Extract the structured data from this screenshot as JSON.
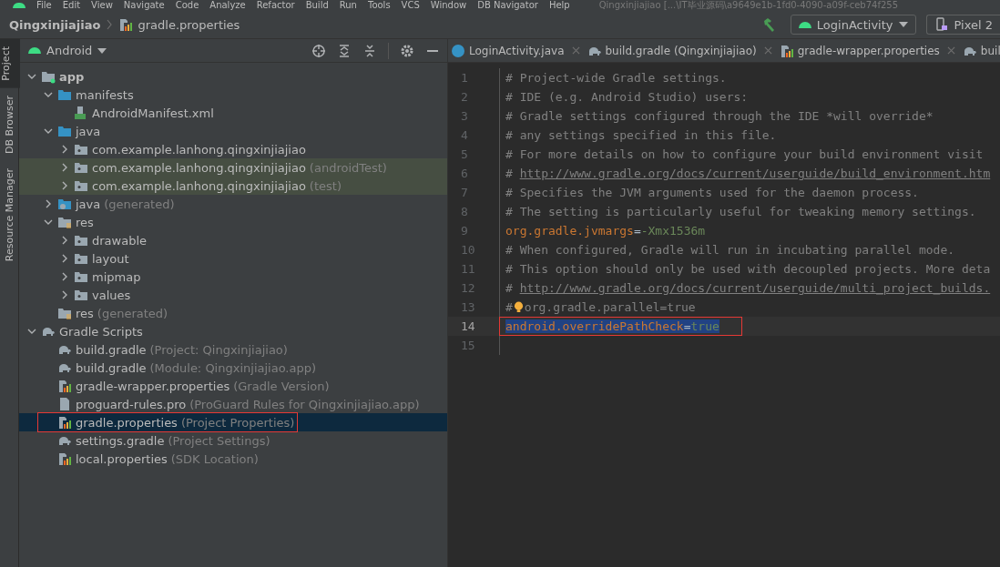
{
  "menu_bar": {
    "items": [
      "File",
      "Edit",
      "View",
      "Navigate",
      "Code",
      "Analyze",
      "Refactor",
      "Build",
      "Run",
      "Tools",
      "VCS",
      "Window",
      "DB Navigator",
      "Help"
    ],
    "window_title": "Qingxinjiajiao [...\\IT毕业源码\\a9649e1b-1fd0-4090-a09f-ceb74f255"
  },
  "breadcrumb": {
    "project": "Qingxinjiajiao",
    "file": "gradle.properties"
  },
  "run_config": {
    "configuration": "LoginActivity",
    "device": "Pixel 2"
  },
  "side_tabs": [
    {
      "label": "Project",
      "selected": true
    },
    {
      "label": "DB Browser",
      "selected": false
    },
    {
      "label": "Resource Manager",
      "selected": false
    }
  ],
  "project_panel": {
    "view": "Android",
    "tree": [
      {
        "name": "app",
        "kind": "module",
        "expanded": true,
        "children": [
          {
            "name": "manifests",
            "kind": "folder",
            "expanded": true,
            "children": [
              {
                "name": "AndroidManifest.xml",
                "kind": "manifest"
              }
            ]
          },
          {
            "name": "java",
            "kind": "folder",
            "expanded": true,
            "children": [
              {
                "name": "com.example.lanhong.qingxinjiajiao",
                "kind": "package",
                "expanded": false
              },
              {
                "name": "com.example.lanhong.qingxinjiajiao",
                "suffix": "(androidTest)",
                "kind": "package",
                "expanded": false,
                "highlighted": true
              },
              {
                "name": "com.example.lanhong.qingxinjiajiao",
                "suffix": "(test)",
                "kind": "package",
                "expanded": false,
                "highlighted": true
              }
            ]
          },
          {
            "name": "java",
            "suffix": "(generated)",
            "kind": "generated",
            "expanded": false
          },
          {
            "name": "res",
            "kind": "res",
            "expanded": true,
            "children": [
              {
                "name": "drawable",
                "kind": "package",
                "expanded": false
              },
              {
                "name": "layout",
                "kind": "package",
                "expanded": false
              },
              {
                "name": "mipmap",
                "kind": "package",
                "expanded": false
              },
              {
                "name": "values",
                "kind": "package",
                "expanded": false
              }
            ]
          },
          {
            "name": "res",
            "suffix": "(generated)",
            "kind": "res"
          }
        ]
      },
      {
        "name": "Gradle Scripts",
        "kind": "gradle",
        "expanded": true,
        "children": [
          {
            "name": "build.gradle",
            "suffix": "(Project: Qingxinjiajiao)",
            "kind": "gradle"
          },
          {
            "name": "build.gradle",
            "suffix": "(Module: Qingxinjiajiao.app)",
            "kind": "gradle"
          },
          {
            "name": "gradle-wrapper.properties",
            "suffix": "(Gradle Version)",
            "kind": "properties"
          },
          {
            "name": "proguard-rules.pro",
            "suffix": "(ProGuard Rules for Qingxinjiajiao.app)",
            "kind": "file"
          },
          {
            "name": "gradle.properties",
            "suffix": "(Project Properties)",
            "kind": "properties",
            "selected": true
          },
          {
            "name": "settings.gradle",
            "suffix": "(Project Settings)",
            "kind": "gradle"
          },
          {
            "name": "local.properties",
            "suffix": "(SDK Location)",
            "kind": "properties"
          }
        ]
      }
    ]
  },
  "editor_tabs": [
    {
      "label": "LoginActivity.java",
      "kind": "class",
      "closable": true
    },
    {
      "label": "build.gradle (Qingxinjiajiao)",
      "kind": "gradle",
      "closable": true
    },
    {
      "label": "gradle-wrapper.properties",
      "kind": "properties",
      "closable": true
    },
    {
      "label": "buil",
      "kind": "gradle",
      "closable": false
    }
  ],
  "editor": {
    "lines": [
      {
        "number": "1",
        "tokens": [
          {
            "kind": "comment",
            "text": "# Project-wide Gradle settings."
          }
        ]
      },
      {
        "number": "2",
        "tokens": [
          {
            "kind": "comment",
            "text": "# IDE (e.g. Android Studio) users:"
          }
        ]
      },
      {
        "number": "3",
        "tokens": [
          {
            "kind": "comment",
            "text": "# Gradle settings configured through the IDE *will override*"
          }
        ]
      },
      {
        "number": "4",
        "tokens": [
          {
            "kind": "comment",
            "text": "# any settings specified in this file."
          }
        ]
      },
      {
        "number": "5",
        "tokens": [
          {
            "kind": "comment",
            "text": "# For more details on how to configure your build environment visit"
          }
        ]
      },
      {
        "number": "6",
        "tokens": [
          {
            "kind": "comment",
            "text": "# "
          },
          {
            "kind": "link",
            "text": "http://www.gradle.org/docs/current/userguide/build_environment.htm"
          }
        ]
      },
      {
        "number": "7",
        "tokens": [
          {
            "kind": "comment",
            "text": "# Specifies the JVM arguments used for the daemon process."
          }
        ]
      },
      {
        "number": "8",
        "tokens": [
          {
            "kind": "comment",
            "text": "# The setting is particularly useful for tweaking memory settings."
          }
        ]
      },
      {
        "number": "9",
        "tokens": [
          {
            "kind": "key",
            "text": "org.gradle.jvmargs"
          },
          {
            "kind": "op",
            "text": "="
          },
          {
            "kind": "value",
            "text": "-Xmx1536m"
          }
        ]
      },
      {
        "number": "10",
        "tokens": [
          {
            "kind": "comment",
            "text": "# When configured, Gradle will run in incubating parallel mode."
          }
        ]
      },
      {
        "number": "11",
        "tokens": [
          {
            "kind": "comment",
            "text": "# This option should only be used with decoupled projects. More deta"
          }
        ]
      },
      {
        "number": "12",
        "tokens": [
          {
            "kind": "comment",
            "text": "# "
          },
          {
            "kind": "link",
            "text": "http://www.gradle.org/docs/current/userguide/multi_project_builds."
          }
        ]
      },
      {
        "number": "13",
        "bulb": true,
        "tokens": [
          {
            "kind": "comment",
            "text": "#"
          },
          {
            "kind": "comment",
            "text": "org.gradle.parallel=true"
          }
        ]
      },
      {
        "number": "14",
        "current": true,
        "selected": true,
        "tokens": [
          {
            "kind": "key",
            "text": "android.overridePathCheck"
          },
          {
            "kind": "op",
            "text": "="
          },
          {
            "kind": "value",
            "text": "true"
          }
        ]
      },
      {
        "number": "15"
      }
    ]
  }
}
